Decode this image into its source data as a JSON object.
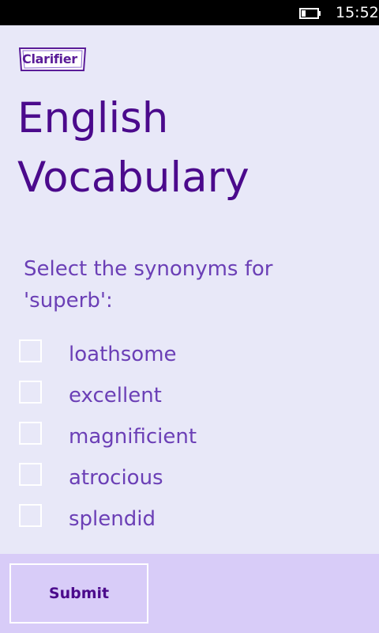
{
  "status_bar": {
    "time": "15:52",
    "battery_icon": "battery-low-icon"
  },
  "logo": {
    "text": "Clarifier",
    "accent_color": "#5a1c98"
  },
  "page": {
    "title": "English Vocabulary",
    "question": "Select the synonyms for 'superb':"
  },
  "options": [
    {
      "label": "loathsome",
      "checked": false
    },
    {
      "label": "excellent",
      "checked": false
    },
    {
      "label": "magnificient",
      "checked": false
    },
    {
      "label": "atrocious",
      "checked": false
    },
    {
      "label": "splendid",
      "checked": false
    }
  ],
  "app_bar": {
    "submit_label": "Submit"
  },
  "colors": {
    "background": "#e8e8f8",
    "title": "#4b0a8c",
    "text": "#6b3fb6",
    "app_bar": "#d8ccf8"
  }
}
